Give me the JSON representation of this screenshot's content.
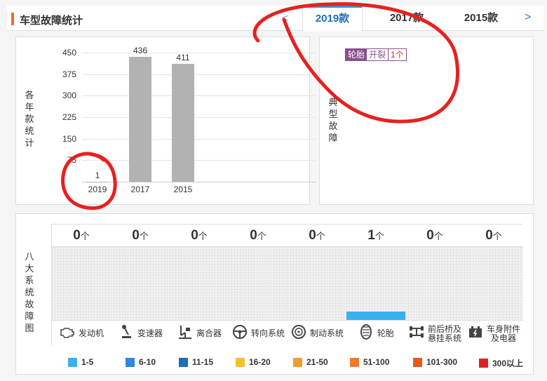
{
  "header": {
    "title": "车型故障统计",
    "prev_arrow": "<",
    "next_arrow": ">",
    "tabs": [
      {
        "label": "2019款",
        "active": true
      },
      {
        "label": "2017款",
        "active": false
      },
      {
        "label": "2015款",
        "active": false
      }
    ]
  },
  "year_chart": {
    "side_label": "各年款统计",
    "chart_data": {
      "type": "bar",
      "categories": [
        "2019",
        "2017",
        "2015"
      ],
      "values": [
        1,
        436,
        411
      ],
      "yticks": [
        "450",
        "375",
        "300",
        "225",
        "150",
        "75"
      ],
      "ylim": [
        0,
        450
      ],
      "grid": true,
      "bar_color": "#b2b2b2"
    }
  },
  "typical_faults": {
    "side_label": "典型故障",
    "tag": {
      "part": "轮胎",
      "fault": "开裂",
      "count": "1个"
    }
  },
  "systems": {
    "side_label": "八大系统故障图",
    "unit": "个",
    "items": [
      {
        "name": "发动机",
        "count": "0",
        "icon": "engine-icon"
      },
      {
        "name": "变速器",
        "count": "0",
        "icon": "gear-shift-icon"
      },
      {
        "name": "离合器",
        "count": "0",
        "icon": "clutch-pedal-icon"
      },
      {
        "name": "转向系统",
        "count": "0",
        "icon": "steering-wheel-icon"
      },
      {
        "name": "制动系统",
        "count": "0",
        "icon": "brake-disc-icon"
      },
      {
        "name": "轮胎",
        "count": "1",
        "icon": "tire-icon",
        "bar_color": "#3ab0f0"
      },
      {
        "name": "前后桥及悬挂系统",
        "line1": "前后桥及",
        "line2": "悬挂系统",
        "count": "0",
        "icon": "axle-icon"
      },
      {
        "name": "车身附件及电器",
        "line1": "车身附件",
        "line2": "及电器",
        "count": "0",
        "icon": "battery-icon"
      }
    ]
  },
  "legend": [
    {
      "label": "1-5",
      "color": "#3ab0f0"
    },
    {
      "label": "6-10",
      "color": "#2e86de"
    },
    {
      "label": "11-15",
      "color": "#1c6fb0"
    },
    {
      "label": "16-20",
      "color": "#f5c12e"
    },
    {
      "label": "21-50",
      "color": "#f59a32"
    },
    {
      "label": "51-100",
      "color": "#f07a28"
    },
    {
      "label": "101-300",
      "color": "#e85a1c"
    },
    {
      "label": "300以上",
      "color": "#e02020"
    }
  ]
}
